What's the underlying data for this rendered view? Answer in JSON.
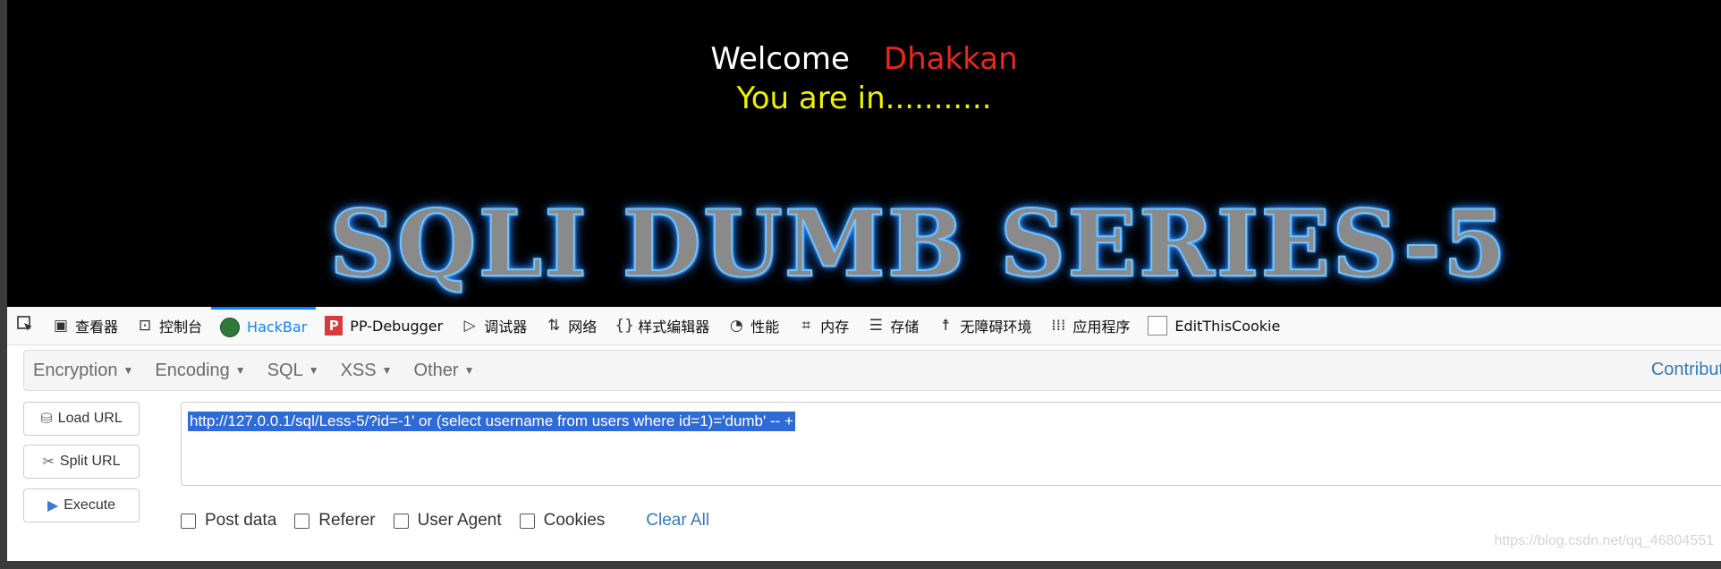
{
  "page": {
    "welcome": "Welcome",
    "name": "Dhakkan",
    "status": "You are in...........",
    "banner": "SQLI DUMB SERIES-5"
  },
  "devtools": {
    "tabs": [
      {
        "label": "查看器",
        "icon": "inspector-icon"
      },
      {
        "label": "控制台",
        "icon": "console-icon"
      },
      {
        "label": "HackBar",
        "icon": "hackbar-icon"
      },
      {
        "label": "PP-Debugger",
        "icon": "pp-debugger-icon"
      },
      {
        "label": "调试器",
        "icon": "debugger-icon"
      },
      {
        "label": "网络",
        "icon": "network-icon"
      },
      {
        "label": "样式编辑器",
        "icon": "style-editor-icon"
      },
      {
        "label": "性能",
        "icon": "performance-icon"
      },
      {
        "label": "内存",
        "icon": "memory-icon"
      },
      {
        "label": "存储",
        "icon": "storage-icon"
      },
      {
        "label": "无障碍环境",
        "icon": "accessibility-icon"
      },
      {
        "label": "应用程序",
        "icon": "application-icon"
      },
      {
        "label": "EditThisCookie",
        "icon": "cookie-icon"
      }
    ],
    "active_tab": "HackBar",
    "accent": "#0a84ff"
  },
  "hackbar": {
    "menus": [
      "Encryption",
      "Encoding",
      "SQL",
      "XSS",
      "Other"
    ],
    "contribute": "Contribut",
    "buttons": {
      "load": "Load URL",
      "split": "Split URL",
      "execute": "Execute"
    },
    "url": "http://127.0.0.1/sql/Less-5/?id=-1' or (select username from users where id=1)='dumb' -- +",
    "checks": [
      "Post data",
      "Referer",
      "User Agent",
      "Cookies"
    ],
    "clear": "Clear All"
  },
  "watermark": "https://blog.csdn.net/qq_46804551"
}
